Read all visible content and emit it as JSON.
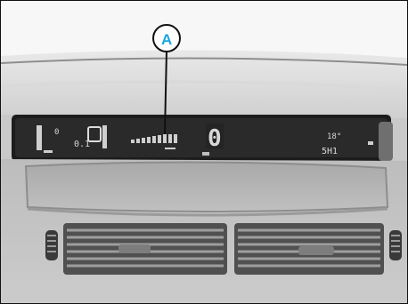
{
  "callout": {
    "letter": "A",
    "color": "#1aa7e0"
  },
  "display": {
    "left_readout": "0.1",
    "left_top_readout": "0",
    "center_digit": "0",
    "right_top": "18°",
    "right_bottom": "5H1"
  }
}
